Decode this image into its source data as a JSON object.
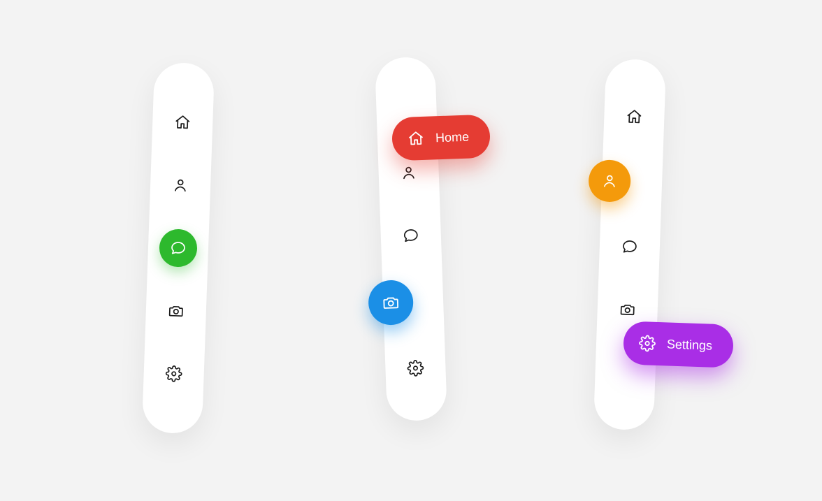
{
  "labels": {
    "home": "Home",
    "profile": "Profile",
    "chat": "Chat",
    "camera": "Camera",
    "settings": "Settings"
  },
  "sidebars": [
    {
      "items": [
        "home",
        "profile",
        "chat",
        "camera",
        "settings"
      ],
      "active_index": 2,
      "active_color": "#2db92d"
    },
    {
      "items": [
        "home",
        "profile",
        "chat",
        "camera",
        "settings"
      ],
      "active_index": 3,
      "active_color": "#1b8fe6",
      "flyout": {
        "index": 0,
        "label_key": "home",
        "color": "#e53c33"
      }
    },
    {
      "items": [
        "home",
        "profile",
        "chat",
        "camera",
        "settings"
      ],
      "active_index": 1,
      "active_color": "#f49a0b",
      "flyout": {
        "index": 4,
        "label_key": "settings",
        "color": "#a92ee6"
      }
    }
  ]
}
